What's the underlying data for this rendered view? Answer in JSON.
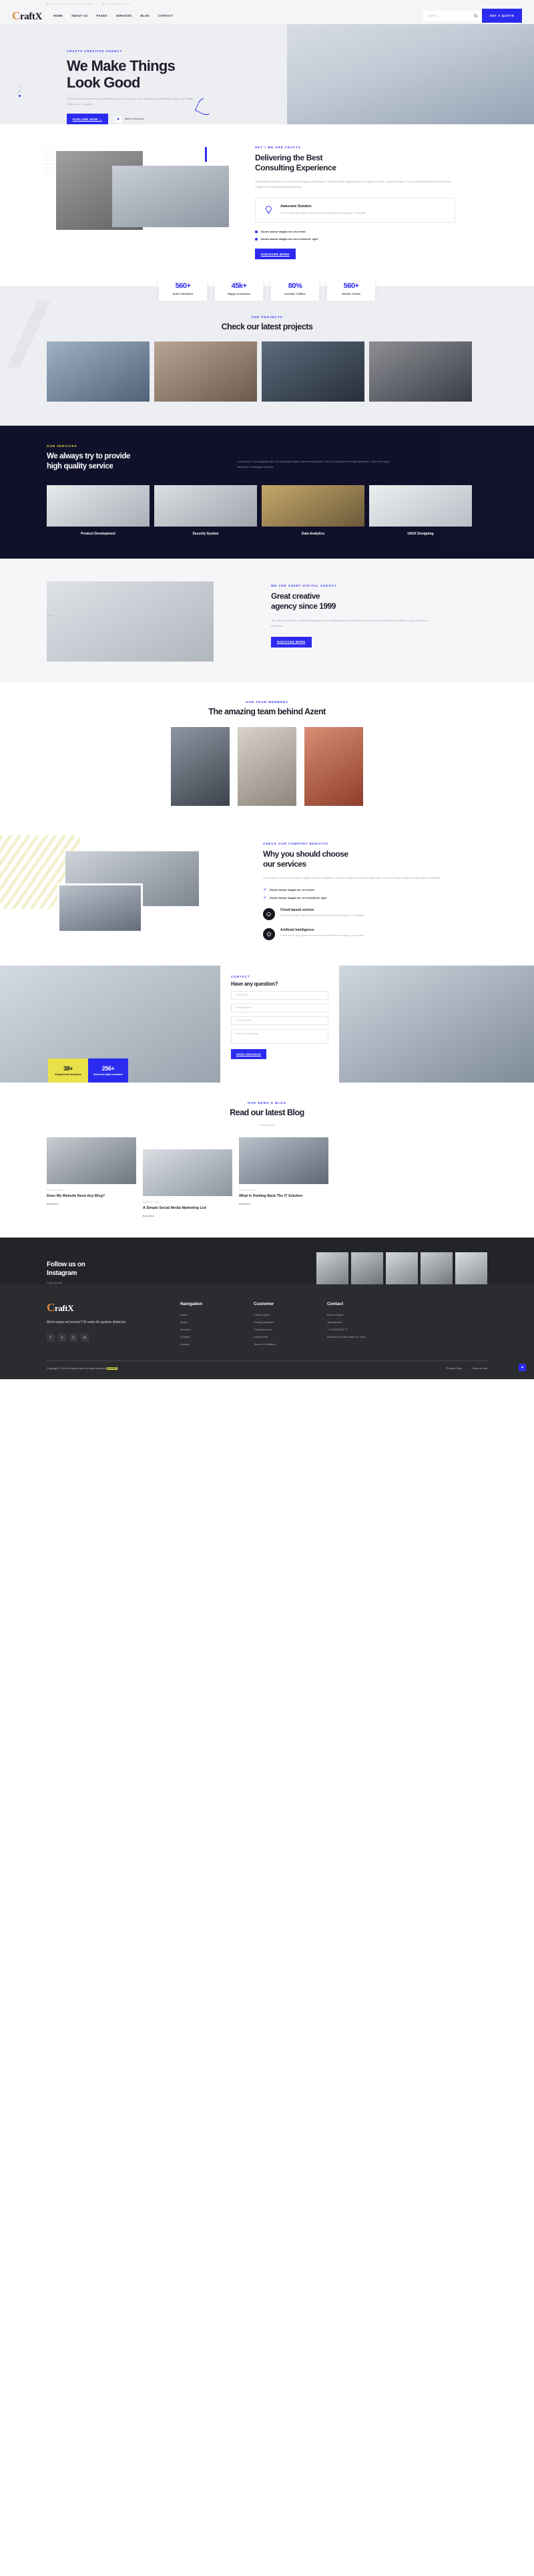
{
  "topbar": {
    "items": [
      {
        "icon": "location-icon",
        "text": "425 SE Street, North West, Thailand"
      },
      {
        "icon": "mail-icon",
        "text": "hello@example.com"
      }
    ]
  },
  "header": {
    "logo": {
      "first": "C",
      "rest": "raftX"
    },
    "nav": [
      "HOME",
      "ABOUT US",
      "PAGES",
      "SERVICES",
      "BLOG",
      "CONTACT"
    ],
    "search_placeholder": "Search...",
    "search_value": "",
    "quote_button": "GET A QUOTE"
  },
  "hero": {
    "eyebrow": "CRAFTX CREATIVE AGENCY",
    "title_line1": "We Make Things",
    "title_line2": "Look Good",
    "paragraph": "Vestibulum at pharetra lectus, id bibendum mi. Cras et justo nisl. Mauris etiam elementum libero est. Mattis vitae dui vel, vulputate",
    "cta_button": "EXPLORE NOW",
    "play_label": "Watch Showreel",
    "slider_dots": 3,
    "active_dot": 3
  },
  "about": {
    "eyebrow": "HEY ! WE ARE CRAFTX",
    "title_line1": "Delivering the Best",
    "title_line2": "Consulting Experience",
    "paragraph": "Suspendisse volutpat mi sit amet mauris egesta pellentesque. Phasellus vitae magna posuere, feugiat nunc vitae, placera smagna. Fusce non pellentesque rhoncus lectus. Ut eget velit volutpat pellentesque iaculis",
    "card": {
      "icon": "lightbulb-icon",
      "title": "Awesome Solution",
      "text": "Fusce luctus ante eget urna elementaa molestie tortor congue. In hacplate"
    },
    "ticks": [
      "Donec auctor magna nec orci hend",
      "Donec auctor magna nec orci hendrerit, eget"
    ],
    "button": "DISCOVER MORE"
  },
  "stats": [
    {
      "number": "560+",
      "label": "Active Members"
    },
    {
      "number": "45k+",
      "label": "Happy Customers"
    },
    {
      "number": "80%",
      "label": "Increase Traffics"
    },
    {
      "number": "560+",
      "label": "Worlds Clients"
    }
  ],
  "projects": {
    "eyebrow": "OUR PROJECTS",
    "title": "Check our latest projects",
    "items": [
      {
        "name": "project-1"
      },
      {
        "name": "project-2"
      },
      {
        "name": "project-3"
      },
      {
        "name": "project-4"
      }
    ]
  },
  "services": {
    "eyebrow": "OUR SERVICES",
    "title_line1": "We always try to provide",
    "title_line2": "high quality service",
    "paragraph": "Lorem ipsum. Proin gravida nibh vel velit auctor aliquet. Aenean sollicitudin, lorem is simply free text quis bibendum. There are many variations of passages of availa",
    "items": [
      {
        "label": "Product Development"
      },
      {
        "label": "Security System"
      },
      {
        "label": "Data Analytics"
      },
      {
        "label": "UI/UX Designing"
      }
    ]
  },
  "agency": {
    "badge": "About",
    "eyebrow": "WE ARE AZENT DIGITAL AGENCY",
    "title_line1": "Great creative",
    "title_line2": "agency since 1999",
    "paragraph": "The main elements of a marketing strategy are your target goals and objectives and the tax you will employ to markter to your achive the goals you",
    "button": "DISCOVER MORE"
  },
  "team": {
    "eyebrow": "OUR TEAM MEMBERS",
    "title": "The amazing team behind Azent",
    "members": [
      {
        "name": "team-member-1"
      },
      {
        "name": "team-member-2"
      },
      {
        "name": "team-member-3"
      }
    ]
  },
  "benefits": {
    "eyebrow": "CHECK OUR COMPANY BENIFITS",
    "title_line1": "Why you should choose",
    "title_line2": "our services",
    "paragraph": "Lorem ipsum. Proin vel velit auctor aliquet. Aenean sollicitudin, lorem is simply free text quis bibendum. There are many variations of passages of avaliable",
    "ticks": [
      "Donec auctor magna nec orci hend",
      "Donec auctor magna nec orci hendrerit, eget"
    ],
    "features": [
      {
        "icon": "cloud-icon",
        "title": "Cloud based serices",
        "text": "Fusce luctus ante eget urna elementaa molestie tortor congue. In hacplate"
      },
      {
        "icon": "ai-chip-icon",
        "title": "Artificial Intelligence",
        "text": "Fusce luctus ante eget urna elementaa molestie tortor congue. In hacplate"
      }
    ]
  },
  "cta": {
    "badges": [
      {
        "number": "38+",
        "label": "Designers and developers"
      },
      {
        "number": "256+",
        "label": "Awards for digital innovation"
      }
    ],
    "eyebrow": "CONTACT",
    "title": "Have any question?",
    "fields": [
      {
        "name": "name-field",
        "placeholder": "Your Name",
        "value": ""
      },
      {
        "name": "email-field",
        "placeholder": "Email Address",
        "value": ""
      },
      {
        "name": "phone-field",
        "placeholder": "Phone Number",
        "value": ""
      },
      {
        "name": "message-field",
        "placeholder": "Write Your Message",
        "value": ""
      }
    ],
    "button": "SEND MESSAGE"
  },
  "blog": {
    "eyebrow": "OUR NEWS & BLOG",
    "title": "Read our latest Blog",
    "follow_note": "Follow @craftx",
    "posts": [
      {
        "date": "March 12, 2024",
        "author": "by Admin",
        "title": "Does My Website Need Any Blog?",
        "more": "Read More"
      },
      {
        "date": "March 12, 2024",
        "author": "by Admin",
        "title": "A Simple Social Media Marketing List",
        "more": "Read More"
      },
      {
        "date": "March 12, 2024",
        "author": "by Admin",
        "title": "What Is Holding Back The IT Solution",
        "more": "Read More"
      }
    ]
  },
  "instagram": {
    "title_line1": "Follow us on",
    "title_line2": "Instagram",
    "subtitle": "Follow @craftx",
    "tiles": 5
  },
  "footer": {
    "logo": {
      "first": "C",
      "rest": "raftX"
    },
    "tagline": "Modi saepe vel tenetur? Et unde illo quidem distinctio.",
    "socials": [
      "facebook-icon",
      "x-icon",
      "instagram-icon",
      "linkedin-icon"
    ],
    "columns": [
      {
        "heading": "Navigation",
        "links": [
          "Home",
          "About",
          "Services",
          "Portfolio",
          "Contact"
        ]
      },
      {
        "heading": "Customer",
        "links": [
          "Client support",
          "Pricing packages",
          "Company story",
          "Latest news",
          "Terms & Condition"
        ]
      },
      {
        "heading": "Contact",
        "links": [
          "Bouvet Island",
          "Jeanetteside",
          "+1-3454-5678-77",
          "53 Brannon Falls Suite NY, USA"
        ]
      }
    ],
    "copyright_main": "Copyright © 2024.Company name All rights reserved.",
    "copyright_mark": "MOHRD",
    "legal": [
      "Privacy Policy",
      "/",
      "Terms of Use"
    ],
    "scroll_top": "scroll-top-icon"
  },
  "colors": {
    "accent": "#2b2bf0",
    "yellow": "#e8e148",
    "dark": "#10102a",
    "footer": "#2b2c30",
    "logo_c": "#e08b3d"
  }
}
